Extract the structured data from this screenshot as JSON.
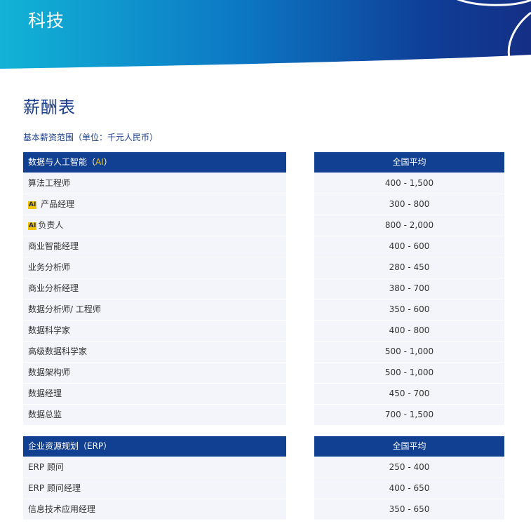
{
  "banner": {
    "title": "科技"
  },
  "page_title": "薪酬表",
  "subtitle": "基本薪资范围（单位：千元人民币）",
  "section1": {
    "header": {
      "pre": "数据与人工智能（",
      "ai": "AI",
      "post": "）"
    },
    "value_header": "全国平均",
    "rows": [
      {
        "badge": "",
        "role": "算法工程师",
        "range": "400 - 1,500"
      },
      {
        "badge": "AI",
        "role": " 产品经理",
        "range": "300 - 800"
      },
      {
        "badge": "AI",
        "role": "负责人",
        "range": "800 - 2,000"
      },
      {
        "badge": "",
        "role": "商业智能经理",
        "range": "400 - 600"
      },
      {
        "badge": "",
        "role": "业务分析师",
        "range": "280 - 450"
      },
      {
        "badge": "",
        "role": "商业分析经理",
        "range": "380 - 700"
      },
      {
        "badge": "",
        "role": "数据分析师/ 工程师",
        "range": "350 - 600"
      },
      {
        "badge": "",
        "role": "数据科学家",
        "range": "400 - 800"
      },
      {
        "badge": "",
        "role": "高级数据科学家",
        "range": "500 - 1,000"
      },
      {
        "badge": "",
        "role": "数据架构师",
        "range": "500 - 1,000"
      },
      {
        "badge": "",
        "role": "数据经理",
        "range": "450 - 700"
      },
      {
        "badge": "",
        "role": "数据总监",
        "range": "700 - 1,500"
      }
    ]
  },
  "section2": {
    "header": "企业资源规划（ERP）",
    "value_header": "全国平均",
    "rows": [
      {
        "role": "ERP 顾问",
        "range": "250 - 400"
      },
      {
        "role": "ERP 顾问经理",
        "range": "400 - 650"
      },
      {
        "role": "信息技术应用经理",
        "range": "350 - 650"
      }
    ]
  },
  "colors": {
    "header_bg": "#113f91",
    "row_bg": "#f3f5fa",
    "title": "#1b3f8f",
    "ai_badge": "#f2c200"
  }
}
